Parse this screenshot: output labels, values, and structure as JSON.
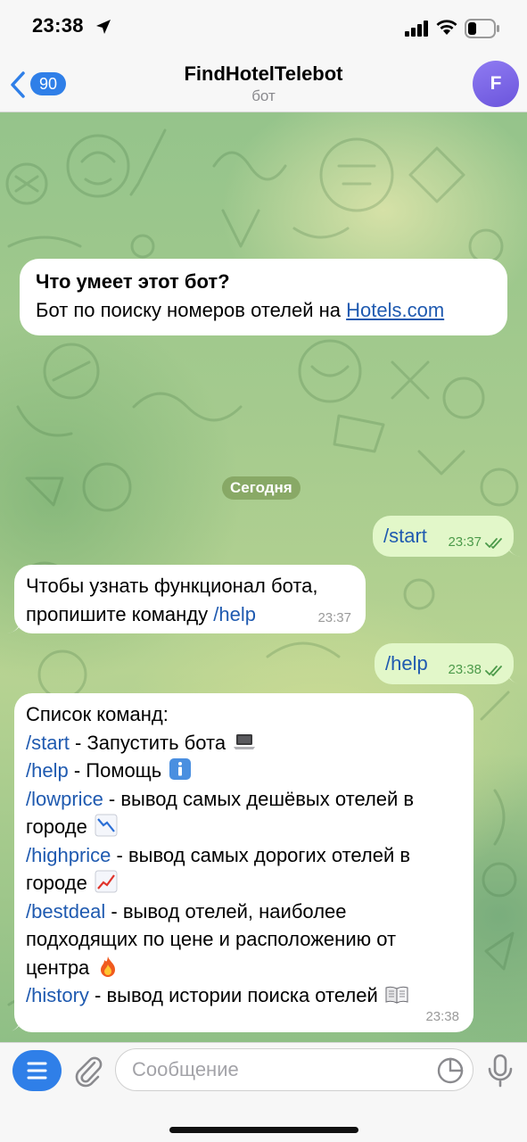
{
  "status_bar": {
    "time": "23:38"
  },
  "header": {
    "back_badge": "90",
    "title": "FindHotelTelebot",
    "subtitle": "бот",
    "avatar_letter": "F"
  },
  "intro": {
    "title": "Что умеет этот бот?",
    "text": "Бот по поиску номеров отелей на ",
    "link": "Hotels.com"
  },
  "date_chip": "Сегодня",
  "messages": [
    {
      "direction": "out",
      "text": "/start",
      "time": "23:37"
    },
    {
      "direction": "in",
      "text_line1": "Чтобы узнать функционал бота,",
      "text_line2": "пропишите команду ",
      "command": "/help",
      "time": "23:37"
    },
    {
      "direction": "out",
      "text": "/help",
      "time": "23:38"
    }
  ],
  "command_list": {
    "heading": "Список команд:",
    "items": [
      {
        "command": "/start",
        "description": " - Запустить бота",
        "icon": "laptop-emoji"
      },
      {
        "command": "/help",
        "description": " - Помощь",
        "icon": "info-emoji"
      },
      {
        "command": "/lowprice",
        "description_line1": " - вывод самых дешёвых отелей в",
        "description_line2": "городе",
        "icon": "chart-decreasing-emoji"
      },
      {
        "command": "/highprice",
        "description_line1": " - вывод самых дорогих отелей в",
        "description_line2": "городе",
        "icon": "chart-increasing-emoji"
      },
      {
        "command": "/bestdeal",
        "description_line1": " - вывод отелей, наиболее",
        "description_line2": "подходящих по цене и расположению от",
        "description_line3": "центра",
        "icon": "fire-emoji"
      },
      {
        "command": "/history",
        "description": " - вывод истории поиска отелей",
        "icon": "open-book-emoji"
      }
    ],
    "time": "23:38"
  },
  "input": {
    "placeholder": "Сообщение"
  },
  "colors": {
    "accent": "#2f7fe8",
    "link": "#1f5ab0",
    "outgoing_bubble": "#e2f7c9",
    "outgoing_time": "#4c9a4a"
  }
}
